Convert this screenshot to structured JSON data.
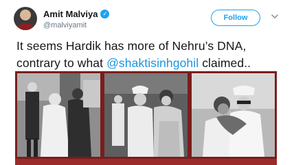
{
  "author": {
    "display_name": "Amit Malviya",
    "verified_glyph": "✓",
    "handle": "@malviyamit"
  },
  "follow_button": {
    "label": "Follow"
  },
  "tweet": {
    "text_before": "It seems Hardik has more of Nehru’s DNA, contrary to what ",
    "mention": "@shaktisinhgohil",
    "text_after": " claimed.."
  },
  "icons": {
    "verified": "verified-badge-icon",
    "menu": "chevron-down-icon"
  },
  "colors": {
    "accent": "#1da1f2",
    "mention": "#1b95e0",
    "frame": "#7a1d1d"
  },
  "media": {
    "photo_count": 3
  }
}
